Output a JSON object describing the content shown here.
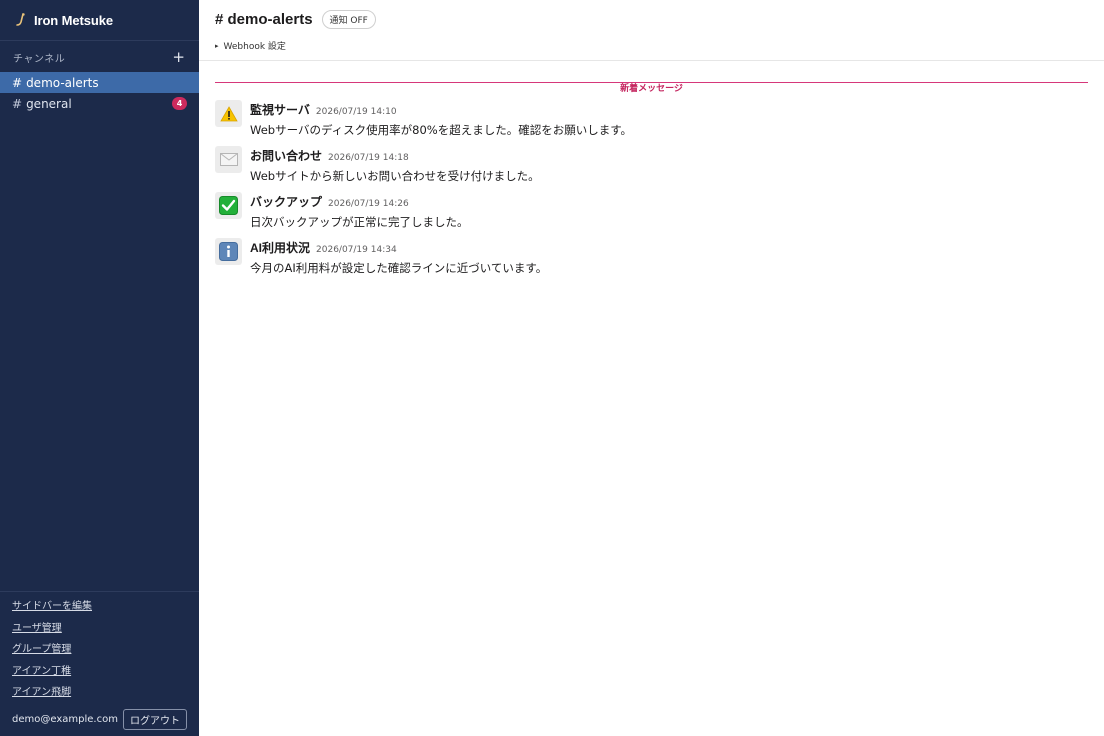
{
  "app": {
    "name": "Iron Metsuke"
  },
  "sidebar": {
    "section_title": "チャンネル",
    "add_label": "+",
    "channels": [
      {
        "hash": "#",
        "name": "demo-alerts",
        "active": true
      },
      {
        "hash": "#",
        "name": "general",
        "unread": "4"
      }
    ],
    "footer_links": [
      "サイドバーを編集",
      "ユーザ管理",
      "グループ管理",
      "アイアン丁稚",
      "アイアン飛脚"
    ],
    "user_email": "demo@example.com",
    "logout_label": "ログアウト"
  },
  "channel_header": {
    "title": "# demo-alerts",
    "notify_label": "通知 OFF",
    "webhook_toggle": "▸",
    "webhook_label": "Webhook 設定"
  },
  "divider_label": "新着メッセージ",
  "messages": [
    {
      "icon": "warning-icon",
      "sender": "監視サーバ",
      "time": "2026/07/19 14:10",
      "text": "Webサーバのディスク使用率が80%を超えました。確認をお願いします。"
    },
    {
      "icon": "envelope-icon",
      "sender": "お問い合わせ",
      "time": "2026/07/19 14:18",
      "text": "Webサイトから新しいお問い合わせを受け付けました。"
    },
    {
      "icon": "check-icon",
      "sender": "バックアップ",
      "time": "2026/07/19 14:26",
      "text": "日次バックアップが正常に完了しました。"
    },
    {
      "icon": "info-icon",
      "sender": "AI利用状況",
      "time": "2026/07/19 14:34",
      "text": "今月のAI利用料が設定した確認ラインに近づいています。"
    }
  ],
  "colors": {
    "sidebar_bg": "#1c2a4a",
    "active_channel": "#3d6aa8",
    "badge": "#cc2b5e",
    "divider": "#d6377a"
  }
}
